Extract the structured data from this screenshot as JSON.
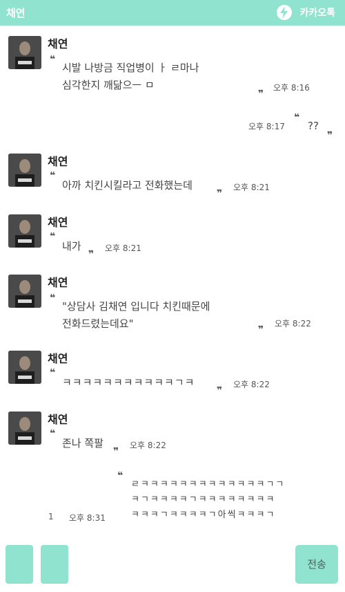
{
  "header": {
    "title": "채연",
    "brand": "카카오톡"
  },
  "messages": [
    {
      "sender": "채연",
      "text": "시발 나방금 직업병이 ㅏ ㄹ마나\n심각한지 깨닮으ㅡ ㅁ",
      "time": "오후 8:16"
    },
    {
      "text": "??",
      "time": "오후 8:17"
    },
    {
      "sender": "채연",
      "text": "아까 치킨시킬라고 전화했는데",
      "time": "오후 8:21"
    },
    {
      "sender": "채연",
      "text": "내가",
      "time": "오후 8:21"
    },
    {
      "sender": "채연",
      "text": "\"상담사 김채연 입니다 치킨때문에\n전화드렸는데요\"",
      "time": "오후 8:22"
    },
    {
      "sender": "채연",
      "text": "ㅋㅋㅋㅋㅋㅋㅋㅋㅋㅋㅋㄱㅋ",
      "time": "오후 8:22"
    },
    {
      "sender": "채연",
      "text": "존나 쪽팔",
      "time": "오후 8:22"
    },
    {
      "text": "ㄹㅋㅋㅋㅋㅋㅋㅋㅋㅋㅋㅋㅋㅋㄱㄱ\nㅋㄱㅋㅋㅋㅋㄱㅋㅋㅋㅋㅋㅋㅋㅋ\nㅋㅋㅋㄱㅋㅋㅋㅋㄱ아씩ㅋㅋㅋㄱ",
      "time": "오후 8:31",
      "unread": "1"
    }
  ],
  "composer": {
    "send_label": "전송"
  },
  "colors": {
    "accent": "#8fe3cf"
  }
}
